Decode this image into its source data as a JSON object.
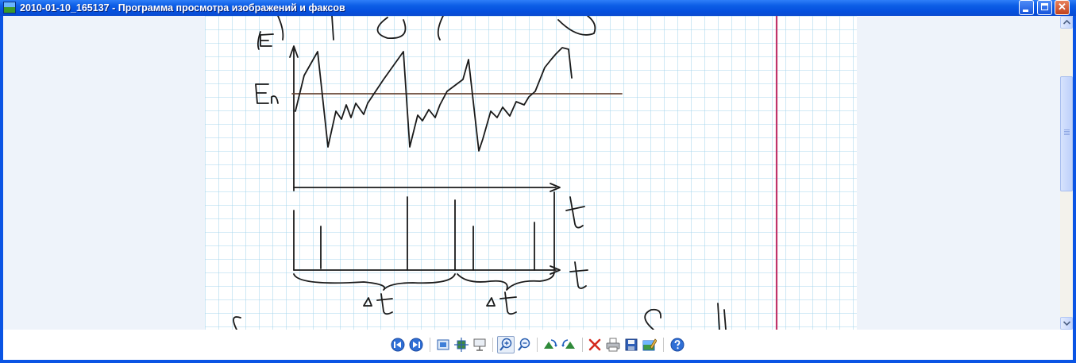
{
  "window": {
    "title": "2010-01-10_165137 - Программа просмотра изображений и факсов",
    "controls": [
      "minimize-icon",
      "maximize-icon",
      "close-icon"
    ]
  },
  "image": {
    "description_icon": "handwritten-graph-image",
    "labels": {
      "y_axis_top": "E",
      "threshold": "En",
      "t_axis_1": "t",
      "t_axis_2": "t",
      "delta_1": "Δt",
      "delta_2": "Δt"
    }
  },
  "toolbar": {
    "buttons": [
      {
        "icon": "previous-image-icon"
      },
      {
        "icon": "next-image-icon"
      },
      {
        "icon": "best-fit-icon"
      },
      {
        "icon": "actual-size-icon"
      },
      {
        "icon": "slideshow-icon"
      },
      {
        "icon": "zoom-in-icon",
        "active": true
      },
      {
        "icon": "zoom-out-icon"
      },
      {
        "icon": "rotate-clockwise-icon"
      },
      {
        "icon": "rotate-counterclockwise-icon"
      },
      {
        "icon": "delete-icon"
      },
      {
        "icon": "print-icon"
      },
      {
        "icon": "save-icon"
      },
      {
        "icon": "open-for-editing-icon"
      },
      {
        "icon": "help-icon"
      }
    ]
  },
  "colors": {
    "titlebar": "#0a54e4",
    "grid": "#9fd3ea",
    "margin_line": "#c0346a",
    "accent_blue": "#1f5fbf"
  }
}
